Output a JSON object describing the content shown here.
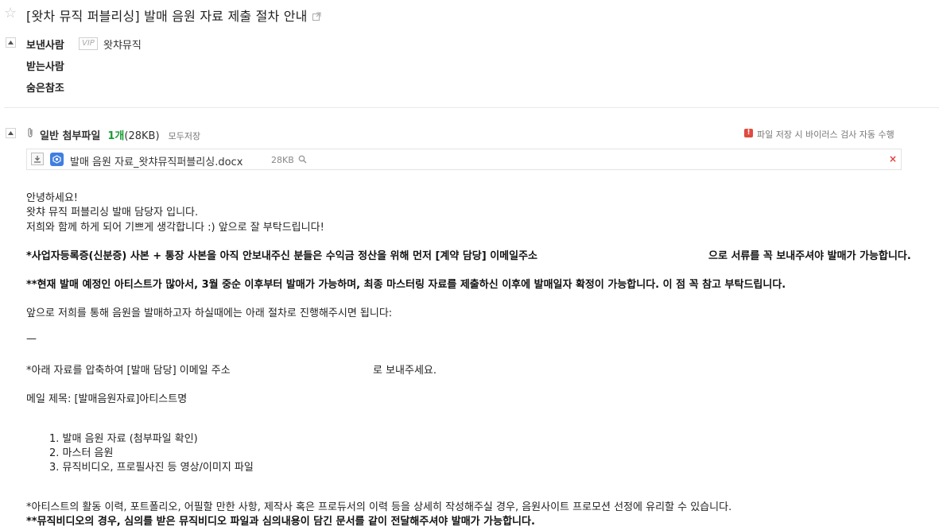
{
  "subject": {
    "title": "[왓차 뮤직 퍼블리싱] 발매 음원 자료 제출 절차 안내"
  },
  "header": {
    "sender_label": "보낸사람",
    "vip_badge": "VIP",
    "sender_name": "왓챠뮤직",
    "recipient_label": "받는사람",
    "bcc_label": "숨은참조"
  },
  "attachment": {
    "title": "일반 첨부파일",
    "count": "1개",
    "total_size": "(28KB)",
    "save_all": "모두저장",
    "virus_notice": "파일 저장 시 바이러스 검사 자동 수행",
    "file": {
      "name": "발매 음원 자료_왓챠뮤직퍼블리싱.docx",
      "size": "28KB"
    }
  },
  "body": {
    "greeting_1": "안녕하세요!",
    "greeting_2": "왓챠 뮤직 퍼블리싱 발매 담당자 입니다.",
    "greeting_3": "저희와 함께 하게 되어 기쁘게 생각합니다 :) 앞으로 잘 부탁드립니다!",
    "notice_1a": "*사업자등록증(신분증) 사본 + 통장 사본을 아직 안보내주신 분들은 수익금 정산을 위해 먼저 [계약 담당] 이메일주소",
    "notice_1b": "으로 서류를 꼭 보내주셔야 발매가 가능합니다.",
    "notice_2": "**현재 발매 예정인 아티스트가 많아서, 3월 중순 이후부터 발매가 가능하며, 최종 마스터링 자료를 제출하신 이후에 발매일자 확정이 가능합니다. 이 점 꼭 참고 부탁드립니다.",
    "intro": "앞으로 저희를 통해 음원을 발매하고자 하실때에는 아래 절차로 진행해주시면 됩니다:",
    "dash": "—",
    "instruction_a": "*아래 자료를 압축하여 [발매 담당] 이메일 주소",
    "instruction_b": "로 보내주세요.",
    "mail_subject": "메일 제목: [발매음원자료]아티스트명",
    "list": [
      "1. 발매 음원 자료 (첨부파일 확인)",
      "2. 마스터 음원",
      "3. 뮤직비디오, 프로필사진 등 영상/이미지 파일"
    ],
    "footnote_1": "*아티스트의 활동 이력, 포트폴리오, 어필할 만한 사항, 제작사 혹은 프로듀서의 이력 등을 상세히 작성해주실 경우, 음원사이트 프로모션 선정에 유리할 수 있습니다.",
    "footnote_2": "**뮤직비디오의 경우, 심의를 받은 뮤직비디오 파일과 심의내용이 담긴 문서를 같이 전달해주셔야 발매가 가능합니다."
  },
  "colors": {
    "accent_green": "#1a9b37",
    "warning_red": "#e04a3f",
    "file_icon_blue": "#3f7fe0"
  }
}
